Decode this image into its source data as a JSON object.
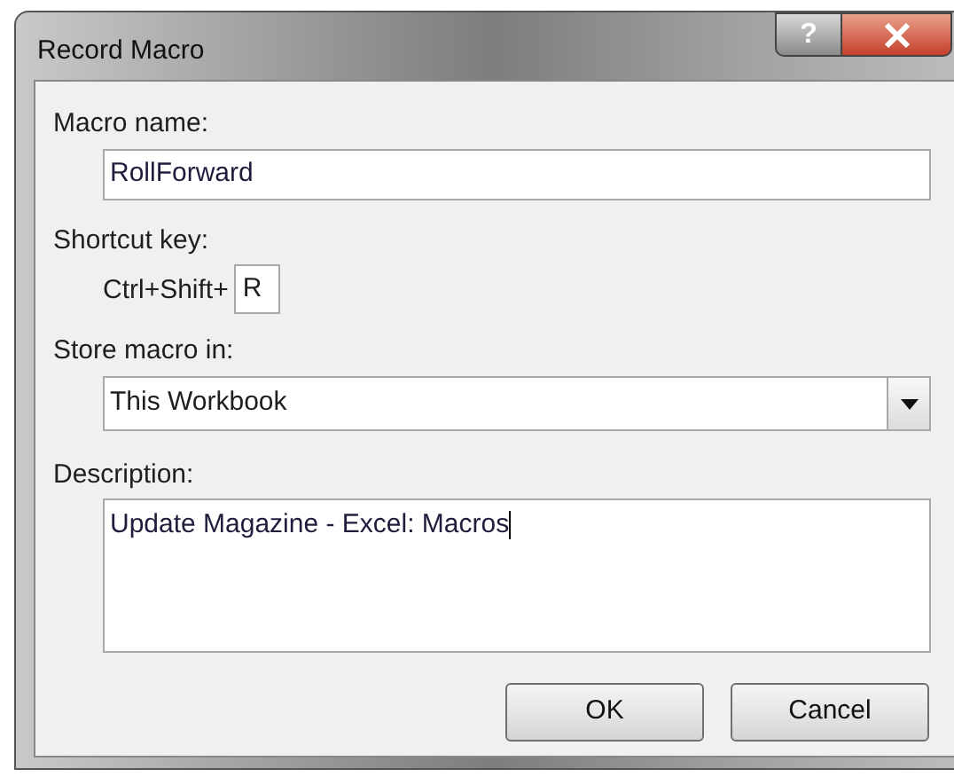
{
  "window": {
    "title": "Record Macro",
    "help": "?"
  },
  "macro_name": {
    "label": "Macro name:",
    "value": "RollForward"
  },
  "shortcut_key": {
    "label": "Shortcut key:",
    "prefix": "Ctrl+Shift+",
    "value": "R"
  },
  "store_macro_in": {
    "label": "Store macro in:",
    "value": "This Workbook"
  },
  "description": {
    "label": "Description:",
    "value": "Update Magazine - Excel: Macros"
  },
  "buttons": [
    {
      "label": "OK"
    },
    {
      "label": "Cancel"
    }
  ]
}
